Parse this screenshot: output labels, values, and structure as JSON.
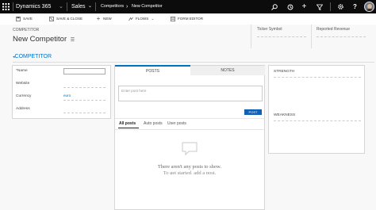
{
  "topnav": {
    "app_name": "Dynamics 365",
    "module": "Sales",
    "crumb_parent": "Competitors",
    "crumb_current": "New Competitor"
  },
  "commands": {
    "save": "SAVE",
    "save_close": "SAVE & CLOSE",
    "new": "NEW",
    "flows": "FLOWS",
    "form_editor": "FORM EDITOR"
  },
  "header": {
    "entity": "COMPETITOR",
    "title": "New Competitor",
    "fields": [
      "Ticker Symbol",
      "Reported Revenue"
    ]
  },
  "general": {
    "section_title": "COMPETITOR",
    "required_marker": "*",
    "fields": [
      {
        "label": "Name",
        "value": ""
      },
      {
        "label": "Website",
        "value": ""
      },
      {
        "label": "Currency",
        "value": "euro"
      },
      {
        "label": "Address",
        "value": ""
      }
    ]
  },
  "social": {
    "tabs": [
      "POSTS",
      "NOTES"
    ],
    "post_placeholder": "Enter post here",
    "post_button": "POST",
    "filters": [
      "All posts",
      "Auto posts",
      "User posts"
    ],
    "empty_title": "There aren't any posts to show.",
    "empty_sub": "To get started, add a post."
  },
  "analysis": {
    "strength_label": "STRENGTH",
    "weakness_label": "WEAKNESS"
  },
  "colors": {
    "nav_bg": "#0c0c0c",
    "accent": "#0072c6"
  }
}
